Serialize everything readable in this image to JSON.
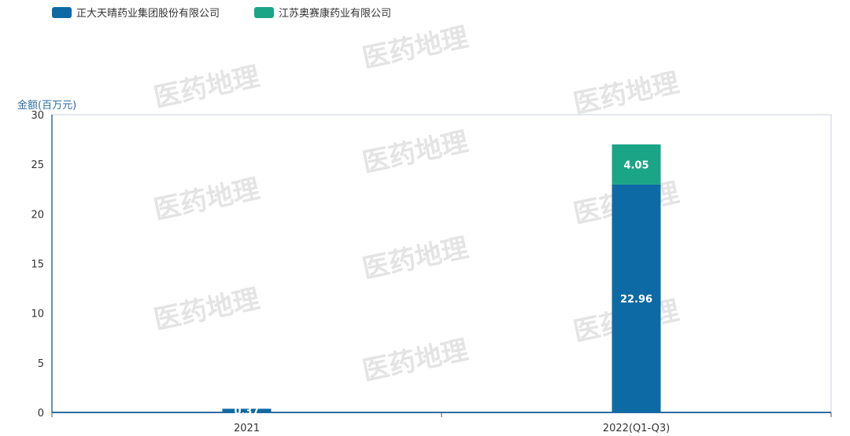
{
  "chart_data": {
    "type": "bar",
    "stacked": true,
    "categories": [
      "2021",
      "2022(Q1-Q3)"
    ],
    "series": [
      {
        "name": "正大天晴药业集团股份有限公司",
        "color": "#0e6aa4",
        "values": [
          0.37,
          22.96
        ],
        "labels": [
          "0.37",
          "22.96"
        ]
      },
      {
        "name": "江苏奥赛康药业有限公司",
        "color": "#1ba587",
        "values": [
          0,
          4.05
        ],
        "labels": [
          "",
          "4.05"
        ]
      }
    ],
    "ylabel": "金额(百万元)",
    "xlabel": "",
    "ylim": [
      0,
      30
    ],
    "yticks": [
      0,
      5,
      10,
      15,
      20,
      25,
      30
    ],
    "legend_position": "top-left",
    "grid": false
  },
  "watermark": "医药地理"
}
